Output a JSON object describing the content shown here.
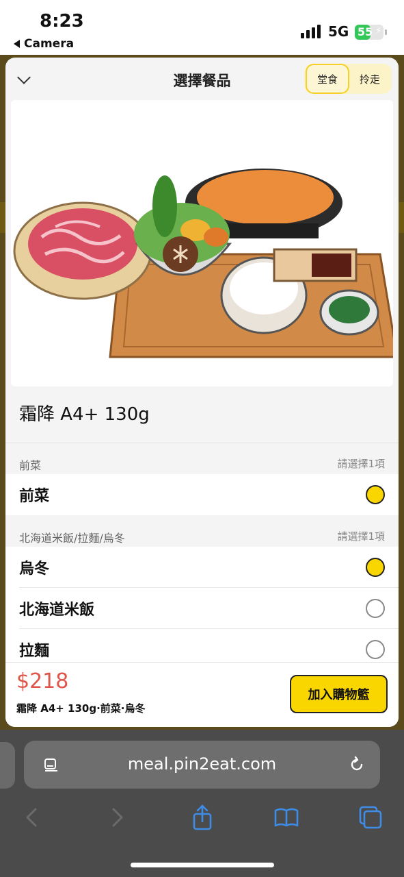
{
  "status_bar": {
    "time": "8:23",
    "back_label": "Camera",
    "network": "5G",
    "battery": "55"
  },
  "sheet": {
    "title": "選擇餐品",
    "mode_options": [
      "堂食",
      "拎走"
    ],
    "selected_mode": "堂食"
  },
  "item": {
    "name": "霜降 A4+ 130g",
    "image_icon": "hotpot-meal-set-image"
  },
  "groups": [
    {
      "title": "前菜",
      "requirement": "請選擇1項",
      "options": [
        {
          "label": "前菜",
          "selected": true
        }
      ]
    },
    {
      "title": "北海道米飯/拉麵/烏冬",
      "requirement": "請選擇1項",
      "options": [
        {
          "label": "烏冬",
          "selected": true
        },
        {
          "label": "北海道米飯",
          "selected": false
        },
        {
          "label": "拉麵",
          "selected": false
        }
      ]
    }
  ],
  "footer": {
    "price": "$218",
    "summary": "霜降 A4+ 130g·前菜·烏冬",
    "add_to_cart": "加入購物籃"
  },
  "browser": {
    "url": "meal.pin2eat.com"
  },
  "colors": {
    "accent_yellow": "#f9d600",
    "price_red": "#e0554a",
    "battery_green": "#33c759"
  }
}
